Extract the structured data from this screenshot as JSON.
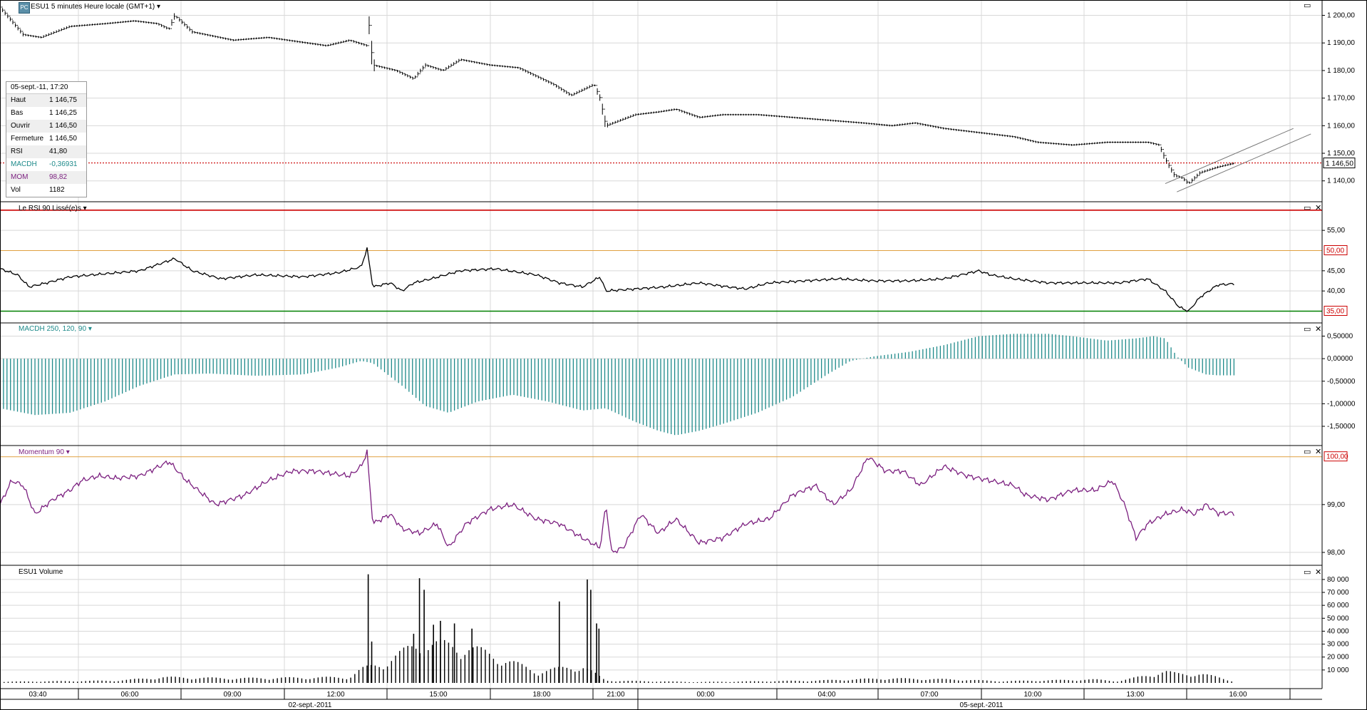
{
  "title": "ESU1 5 minutes Heure locale (GMT+1)",
  "title_badge": "PC",
  "colors": {
    "grid": "#d8d8d8",
    "price": "#000000",
    "rsi": "#000000",
    "macd": "#1e8a8a",
    "mom": "#7b1f7f",
    "vol": "#000000",
    "last": "#cc0000",
    "hi": "#cc0000",
    "mid": "#e0a040",
    "lo": "#008000",
    "axisBorder": "#000000"
  },
  "info_panel": {
    "date": "05-sept.-11, 17:20",
    "rows": [
      {
        "k": "Haut",
        "v": "1 146,75",
        "color": "#000000"
      },
      {
        "k": "Bas",
        "v": "1 146,25",
        "color": "#000000"
      },
      {
        "k": "Ouvrir",
        "v": "1 146,50",
        "color": "#000000"
      },
      {
        "k": "Fermeture",
        "v": "1 146,50",
        "color": "#000000"
      },
      {
        "k": "RSI",
        "v": "41,80",
        "color": "#000000"
      },
      {
        "k": "MACDH",
        "v": "-0,36931",
        "color": "#1e8a8a"
      },
      {
        "k": "MOM",
        "v": "98,82",
        "color": "#7b1f7f"
      },
      {
        "k": "Vol",
        "v": "1182",
        "color": "#000000"
      }
    ]
  },
  "panels": {
    "rsi": {
      "label": "Le RSI 90 Lissé(e)s"
    },
    "macd": {
      "label": "MACDH 250, 120, 90"
    },
    "mom": {
      "label": "Momentum 90"
    },
    "vol": {
      "label": "ESU1 Volume"
    }
  },
  "time_axis": {
    "ticks": [
      "03:40",
      "06:00",
      "09:00",
      "12:00",
      "15:00",
      "18:00",
      "21:00",
      "00:00",
      "04:00",
      "07:00",
      "10:00",
      "13:00",
      "16:00"
    ],
    "dates": [
      "02-sept.-2011",
      "05-sept.-2011"
    ]
  },
  "chart_data": [
    {
      "type": "bar",
      "name": "ESU1 price (OHLC, 5 min)",
      "last_value_label": "1 146,50",
      "last_value": 1146.5,
      "y_ticks": [
        "1 200,00",
        "1 190,00",
        "1 180,00",
        "1 170,00",
        "1 160,00",
        "1 150,00",
        "1 140,00"
      ],
      "y_tick_values": [
        1200,
        1190,
        1180,
        1170,
        1160,
        1150,
        1140
      ],
      "ylim": [
        1134.5,
        1203.5
      ],
      "path": [
        [
          0,
          1203
        ],
        [
          14,
          1196
        ],
        [
          20,
          1193
        ],
        [
          35,
          1192
        ],
        [
          60,
          1196
        ],
        [
          90,
          1197
        ],
        [
          115,
          1198
        ],
        [
          135,
          1197
        ],
        [
          145,
          1195
        ],
        [
          150,
          1200
        ],
        [
          165,
          1194
        ],
        [
          200,
          1191
        ],
        [
          230,
          1192
        ],
        [
          280,
          1189
        ],
        [
          300,
          1191
        ],
        [
          315,
          1189
        ],
        [
          316,
          1200
        ],
        [
          320,
          1182
        ],
        [
          340,
          1180
        ],
        [
          355,
          1177
        ],
        [
          365,
          1182
        ],
        [
          380,
          1180
        ],
        [
          395,
          1184
        ],
        [
          420,
          1182
        ],
        [
          445,
          1181
        ],
        [
          460,
          1178
        ],
        [
          475,
          1175
        ],
        [
          490,
          1171
        ],
        [
          510,
          1175
        ],
        [
          515,
          1170
        ],
        [
          520,
          1160
        ],
        [
          545,
          1164
        ],
        [
          565,
          1165
        ],
        [
          580,
          1166
        ],
        [
          600,
          1163
        ],
        [
          620,
          1164
        ],
        [
          650,
          1164
        ],
        [
          680,
          1163
        ],
        [
          710,
          1162
        ],
        [
          740,
          1161
        ],
        [
          765,
          1160
        ],
        [
          785,
          1161
        ],
        [
          810,
          1159
        ],
        [
          830,
          1158
        ],
        [
          870,
          1156
        ],
        [
          890,
          1154
        ],
        [
          920,
          1153
        ],
        [
          950,
          1154
        ],
        [
          985,
          1154
        ],
        [
          995,
          1153
        ],
        [
          1000,
          1148
        ],
        [
          1008,
          1142
        ],
        [
          1015,
          1141
        ],
        [
          1020,
          1139
        ],
        [
          1030,
          1143
        ],
        [
          1045,
          1145
        ],
        [
          1060,
          1146.5
        ]
      ],
      "channel": [
        [
          [
            1000,
            1139
          ],
          [
            1110,
            1159
          ]
        ],
        [
          [
            1010,
            1136
          ],
          [
            1125,
            1157
          ]
        ]
      ]
    },
    {
      "type": "line",
      "name": "RSI 90",
      "y_ticks": [
        "55,00",
        "45,00",
        "40,00"
      ],
      "y_tick_values": [
        55,
        45,
        40
      ],
      "levels": [
        {
          "value": 60,
          "label": ""
        },
        {
          "value": 50,
          "label": "50,00"
        },
        {
          "value": 35,
          "label": "35,00"
        }
      ],
      "ylim": [
        33.5,
        60.5
      ],
      "path": [
        [
          0,
          45.5
        ],
        [
          15,
          44
        ],
        [
          25,
          41
        ],
        [
          40,
          42
        ],
        [
          60,
          43.5
        ],
        [
          80,
          44
        ],
        [
          100,
          44.5
        ],
        [
          120,
          45
        ],
        [
          150,
          48
        ],
        [
          165,
          45
        ],
        [
          190,
          43
        ],
        [
          220,
          44
        ],
        [
          260,
          43.5
        ],
        [
          290,
          44.5
        ],
        [
          310,
          46
        ],
        [
          315,
          50.5
        ],
        [
          320,
          41
        ],
        [
          335,
          42
        ],
        [
          345,
          40
        ],
        [
          355,
          42
        ],
        [
          370,
          43
        ],
        [
          395,
          45
        ],
        [
          425,
          45.5
        ],
        [
          460,
          44
        ],
        [
          480,
          42
        ],
        [
          500,
          41
        ],
        [
          515,
          43.5
        ],
        [
          520,
          40
        ],
        [
          545,
          40.5
        ],
        [
          570,
          41
        ],
        [
          600,
          42
        ],
        [
          625,
          41
        ],
        [
          640,
          40.5
        ],
        [
          660,
          42
        ],
        [
          690,
          42.5
        ],
        [
          720,
          43
        ],
        [
          750,
          42.5
        ],
        [
          780,
          42.5
        ],
        [
          810,
          43
        ],
        [
          840,
          45
        ],
        [
          850,
          44
        ],
        [
          870,
          43
        ],
        [
          900,
          42
        ],
        [
          930,
          42
        ],
        [
          960,
          42
        ],
        [
          985,
          43
        ],
        [
          1000,
          40
        ],
        [
          1012,
          36
        ],
        [
          1020,
          35
        ],
        [
          1030,
          38.5
        ],
        [
          1045,
          41.5
        ],
        [
          1060,
          41.8
        ]
      ]
    },
    {
      "type": "bar",
      "name": "MACDH 250, 120, 90",
      "y_ticks": [
        "0,50000",
        "0,00000",
        "-0,50000",
        "-1,00000",
        "-1,50000"
      ],
      "y_tick_values": [
        0.5,
        0.0,
        -0.5,
        -1.0,
        -1.5
      ],
      "ylim": [
        -1.8,
        0.65
      ],
      "path": [
        [
          0,
          -1.1
        ],
        [
          30,
          -1.25
        ],
        [
          60,
          -1.2
        ],
        [
          90,
          -0.95
        ],
        [
          120,
          -0.6
        ],
        [
          150,
          -0.35
        ],
        [
          180,
          -0.33
        ],
        [
          220,
          -0.38
        ],
        [
          260,
          -0.35
        ],
        [
          290,
          -0.2
        ],
        [
          310,
          -0.05
        ],
        [
          320,
          -0.1
        ],
        [
          345,
          -0.6
        ],
        [
          365,
          -1.05
        ],
        [
          385,
          -1.2
        ],
        [
          410,
          -0.95
        ],
        [
          440,
          -0.8
        ],
        [
          470,
          -0.95
        ],
        [
          500,
          -1.15
        ],
        [
          520,
          -1.1
        ],
        [
          545,
          -1.4
        ],
        [
          565,
          -1.6
        ],
        [
          580,
          -1.7
        ],
        [
          600,
          -1.6
        ],
        [
          620,
          -1.45
        ],
        [
          650,
          -1.2
        ],
        [
          680,
          -0.85
        ],
        [
          710,
          -0.35
        ],
        [
          730,
          -0.05
        ],
        [
          750,
          0.05
        ],
        [
          780,
          0.15
        ],
        [
          810,
          0.3
        ],
        [
          840,
          0.5
        ],
        [
          870,
          0.55
        ],
        [
          900,
          0.55
        ],
        [
          920,
          0.5
        ],
        [
          950,
          0.4
        ],
        [
          975,
          0.45
        ],
        [
          990,
          0.5
        ],
        [
          1000,
          0.45
        ],
        [
          1010,
          0.05
        ],
        [
          1020,
          -0.2
        ],
        [
          1035,
          -0.35
        ],
        [
          1045,
          -0.37
        ],
        [
          1060,
          -0.37
        ]
      ]
    },
    {
      "type": "line",
      "name": "Momentum 90",
      "y_ticks": [
        "99,00",
        "98,00"
      ],
      "y_tick_values": [
        99,
        98
      ],
      "levels": [
        {
          "value": 100,
          "label": "100,00"
        }
      ],
      "ylim": [
        97.85,
        100.1
      ],
      "path": [
        [
          0,
          99
        ],
        [
          10,
          99.5
        ],
        [
          20,
          99.4
        ],
        [
          30,
          98.8
        ],
        [
          45,
          99.1
        ],
        [
          60,
          99.3
        ],
        [
          70,
          99.5
        ],
        [
          85,
          99.6
        ],
        [
          100,
          99.55
        ],
        [
          120,
          99.6
        ],
        [
          145,
          99.9
        ],
        [
          160,
          99.5
        ],
        [
          185,
          99
        ],
        [
          210,
          99.2
        ],
        [
          230,
          99.5
        ],
        [
          250,
          99.7
        ],
        [
          270,
          99.7
        ],
        [
          300,
          99.6
        ],
        [
          310,
          99.8
        ],
        [
          315,
          100.1
        ],
        [
          320,
          98.6
        ],
        [
          335,
          98.8
        ],
        [
          345,
          98.5
        ],
        [
          360,
          98.4
        ],
        [
          375,
          98.6
        ],
        [
          385,
          98.1
        ],
        [
          400,
          98.6
        ],
        [
          420,
          98.9
        ],
        [
          440,
          99
        ],
        [
          460,
          98.7
        ],
        [
          480,
          98.6
        ],
        [
          500,
          98.3
        ],
        [
          515,
          98.1
        ],
        [
          520,
          99
        ],
        [
          525,
          98
        ],
        [
          535,
          98.1
        ],
        [
          550,
          98.8
        ],
        [
          565,
          98.4
        ],
        [
          580,
          98.7
        ],
        [
          600,
          98.2
        ],
        [
          620,
          98.3
        ],
        [
          640,
          98.6
        ],
        [
          660,
          98.7
        ],
        [
          680,
          99.2
        ],
        [
          700,
          99.4
        ],
        [
          715,
          99
        ],
        [
          730,
          99.3
        ],
        [
          745,
          100
        ],
        [
          760,
          99.7
        ],
        [
          775,
          99.7
        ],
        [
          790,
          99.4
        ],
        [
          810,
          99.8
        ],
        [
          830,
          99.6
        ],
        [
          850,
          99.5
        ],
        [
          870,
          99.4
        ],
        [
          880,
          99.2
        ],
        [
          900,
          99.1
        ],
        [
          920,
          99.3
        ],
        [
          940,
          99.3
        ],
        [
          955,
          99.5
        ],
        [
          965,
          99
        ],
        [
          975,
          98.3
        ],
        [
          985,
          98.6
        ],
        [
          1000,
          98.8
        ],
        [
          1015,
          98.9
        ],
        [
          1025,
          98.8
        ],
        [
          1035,
          99
        ],
        [
          1045,
          98.82
        ]
      ]
    },
    {
      "type": "bar",
      "name": "ESU1 Volume",
      "y_ticks": [
        "80 000",
        "70 000",
        "60 000",
        "50 000",
        "40 000",
        "30 000",
        "20 000",
        "10 000"
      ],
      "y_tick_values": [
        80000,
        70000,
        60000,
        50000,
        40000,
        30000,
        20000,
        10000
      ],
      "ylim": [
        0,
        86000
      ],
      "last_value": 1182,
      "spikes": [
        [
          316,
          84000
        ],
        [
          319,
          32000
        ],
        [
          355,
          38000
        ],
        [
          360,
          81000
        ],
        [
          364,
          72000
        ],
        [
          372,
          45000
        ],
        [
          378,
          48000
        ],
        [
          390,
          46000
        ],
        [
          405,
          42000
        ],
        [
          480,
          63000
        ],
        [
          504,
          80000
        ],
        [
          507,
          72000
        ],
        [
          512,
          46000
        ],
        [
          514,
          42000
        ]
      ],
      "path": [
        [
          0,
          1000
        ],
        [
          100,
          2000
        ],
        [
          140,
          5000
        ],
        [
          200,
          4000
        ],
        [
          300,
          5000
        ],
        [
          310,
          12000
        ],
        [
          330,
          18000
        ],
        [
          360,
          35000
        ],
        [
          400,
          32000
        ],
        [
          430,
          22000
        ],
        [
          460,
          10000
        ],
        [
          500,
          15000
        ],
        [
          520,
          2000
        ],
        [
          600,
          800
        ],
        [
          700,
          2000
        ],
        [
          760,
          4000
        ],
        [
          820,
          3000
        ],
        [
          860,
          1500
        ],
        [
          940,
          3000
        ],
        [
          960,
          1500
        ],
        [
          1000,
          10000
        ],
        [
          1010,
          8000
        ],
        [
          1030,
          8000
        ],
        [
          1045,
          5000
        ],
        [
          1060,
          1182
        ]
      ]
    }
  ]
}
